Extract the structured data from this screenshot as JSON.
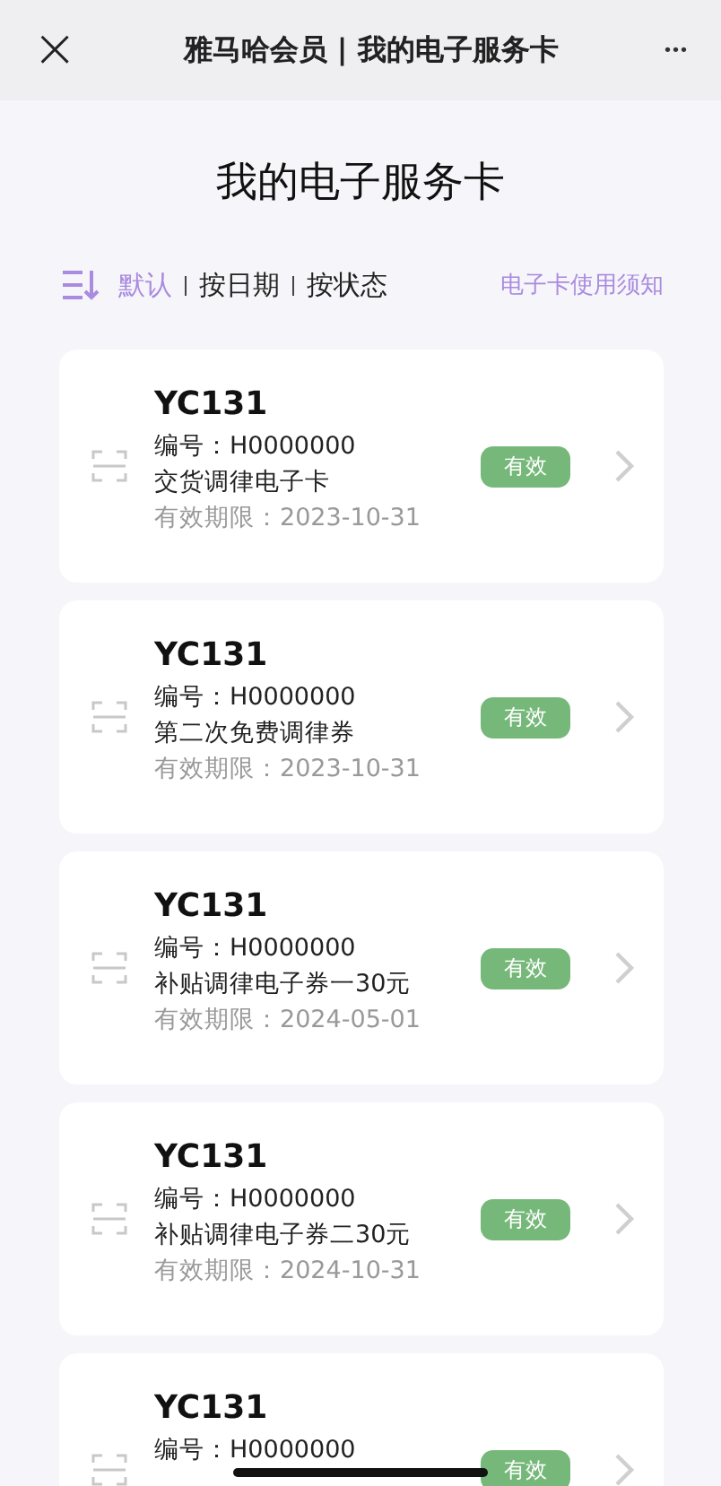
{
  "header": {
    "close": "×",
    "title": "雅马哈会员 | 我的电子服务卡",
    "more": "•••"
  },
  "page_title": "我的电子服务卡",
  "sort_options": [
    {
      "label": "默认",
      "selected": true
    },
    {
      "label": "按日期",
      "selected": false
    },
    {
      "label": "按状态",
      "selected": false
    }
  ],
  "notice_link": "电子卡使用须知",
  "cards": [
    {
      "model": "YC131",
      "number": "编号：H0000000",
      "name": "交货调律电子卡",
      "expiry": "有效期限：2023-10-31",
      "status": "有效"
    },
    {
      "model": "YC131",
      "number": "编号：H0000000",
      "name": "第二次免费调律券",
      "expiry": "有效期限：2023-10-31",
      "status": "有效"
    },
    {
      "model": "YC131",
      "number": "编号：H0000000",
      "name": "补贴调律电子券一30元",
      "expiry": "有效期限：2024-05-01",
      "status": "有效"
    },
    {
      "model": "YC131",
      "number": "编号：H0000000",
      "name": "补贴调律电子券二30元",
      "expiry": "有效期限：2024-10-31",
      "status": "有效"
    },
    {
      "model": "YC131",
      "number": "编号：H0000000",
      "status": "有效"
    }
  ]
}
